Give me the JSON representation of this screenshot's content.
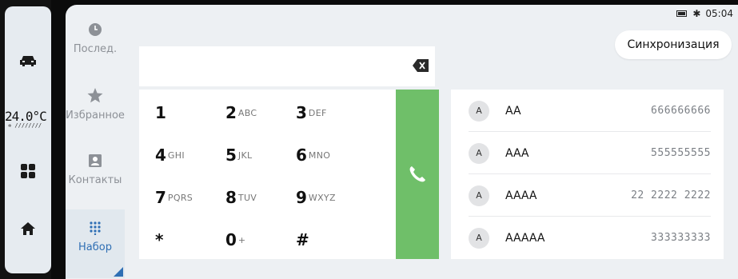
{
  "status": {
    "time": "05:04",
    "battery_icon": "battery-icon",
    "bt_icon": "bluetooth-icon"
  },
  "vehicle_sidebar": {
    "temperature": "24.0°C",
    "fan_level": "fan-level-indicator",
    "items": [
      {
        "icon": "car-icon"
      },
      {
        "icon": "grid-icon"
      },
      {
        "icon": "home-icon"
      }
    ]
  },
  "phone_nav": {
    "tabs": [
      {
        "label": "Послед.",
        "icon": "clock-icon"
      },
      {
        "label": "Избранное",
        "icon": "star-icon"
      },
      {
        "label": "Контакты",
        "icon": "contact-card-icon"
      },
      {
        "label": "Набор",
        "icon": "dialpad-icon",
        "active": true
      }
    ]
  },
  "sync_button": {
    "label": "Синхронизация"
  },
  "dial_field": {
    "value": ""
  },
  "keypad": {
    "keys": [
      {
        "digit": "1",
        "letters": ""
      },
      {
        "digit": "2",
        "letters": "ABC"
      },
      {
        "digit": "3",
        "letters": "DEF"
      },
      {
        "digit": "4",
        "letters": "GHI"
      },
      {
        "digit": "5",
        "letters": "JKL"
      },
      {
        "digit": "6",
        "letters": "MNO"
      },
      {
        "digit": "7",
        "letters": "PQRS"
      },
      {
        "digit": "8",
        "letters": "TUV"
      },
      {
        "digit": "9",
        "letters": "WXYZ"
      },
      {
        "digit": "*",
        "letters": ""
      },
      {
        "digit": "0",
        "letters": "+"
      },
      {
        "digit": "#",
        "letters": ""
      }
    ]
  },
  "contacts": [
    {
      "initial": "A",
      "name": "AA",
      "number": "666666666"
    },
    {
      "initial": "A",
      "name": "AAA",
      "number": "555555555"
    },
    {
      "initial": "A",
      "name": "AAAA",
      "number": "22 2222 2222"
    },
    {
      "initial": "A",
      "name": "AAAAA",
      "number": "333333333"
    }
  ],
  "colors": {
    "accent": "#2f6fb4",
    "call_green": "#6fbf69"
  }
}
